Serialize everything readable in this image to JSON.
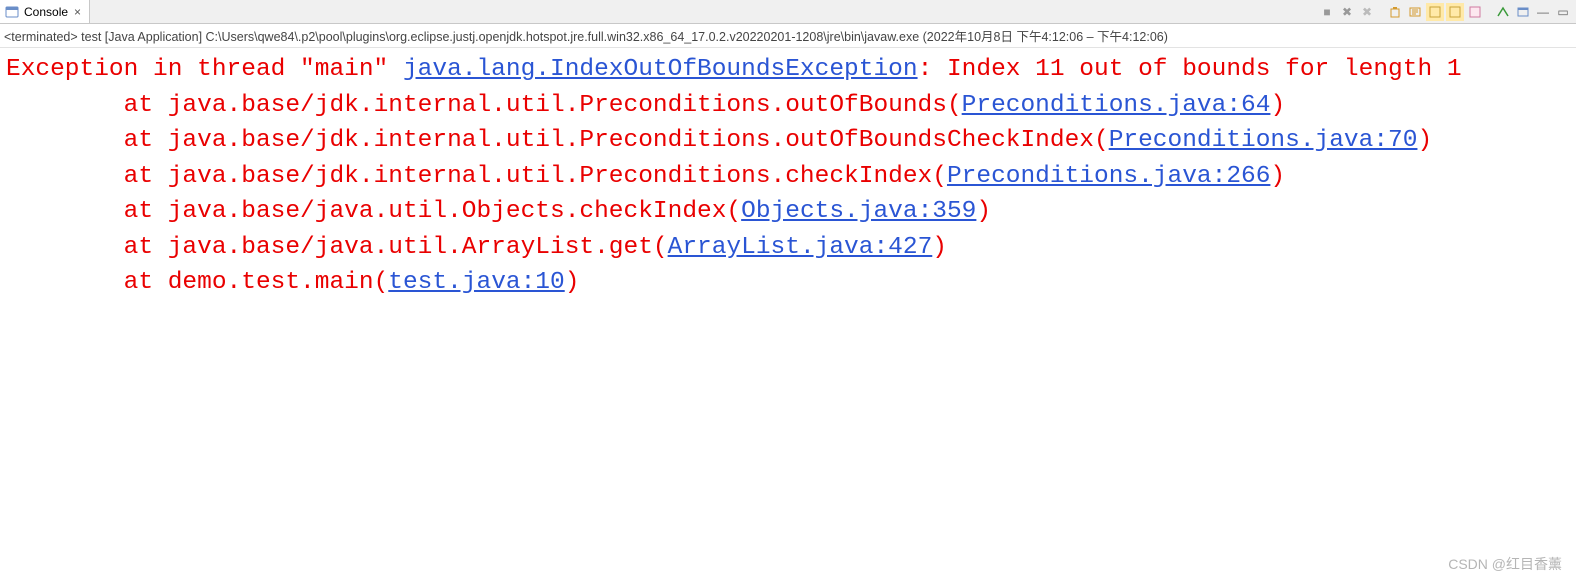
{
  "tab": {
    "title": "Console",
    "close": "×"
  },
  "toolbar_icons": {
    "terminate_grey": "■",
    "remove_all_grey": "✖",
    "remove_all_grey2": "✖",
    "clear": "🗑",
    "scroll_lock": "🔒",
    "word_wrap": "↩",
    "pin": "📌",
    "display": "🖥",
    "open_console": "▭",
    "new_console": "▢",
    "min": "—",
    "max": "▭"
  },
  "status": {
    "prefix": "<terminated>",
    "name": " test [Java Application] C:\\Users\\qwe84\\.p2\\pool\\plugins\\org.eclipse.justj.openjdk.hotspot.jre.full.win32.x86_64_17.0.2.v20220201-1208\\jre\\bin\\javaw.exe  (2022年10月8日 下午4:12:06 – 下午4:12:06)"
  },
  "trace": {
    "head_a": "Exception in thread \"main\" ",
    "exception_link": "java.lang.IndexOutOfBoundsException",
    "head_b": ": Index 11 out of bounds for length 1",
    "frames": [
      {
        "pre": "\tat java.base/jdk.internal.util.Preconditions.outOfBounds(",
        "link": "Preconditions.java:64",
        "post": ")"
      },
      {
        "pre": "\tat java.base/jdk.internal.util.Preconditions.outOfBoundsCheckIndex(",
        "link": "Preconditions.java:70",
        "post": ")"
      },
      {
        "pre": "\tat java.base/jdk.internal.util.Preconditions.checkIndex(",
        "link": "Preconditions.java:266",
        "post": ")"
      },
      {
        "pre": "\tat java.base/java.util.Objects.checkIndex(",
        "link": "Objects.java:359",
        "post": ")"
      },
      {
        "pre": "\tat java.base/java.util.ArrayList.get(",
        "link": "ArrayList.java:427",
        "post": ")"
      },
      {
        "pre": "\tat demo.test.main(",
        "link": "test.java:10",
        "post": ")"
      }
    ]
  },
  "watermark": "CSDN @红目香薰"
}
